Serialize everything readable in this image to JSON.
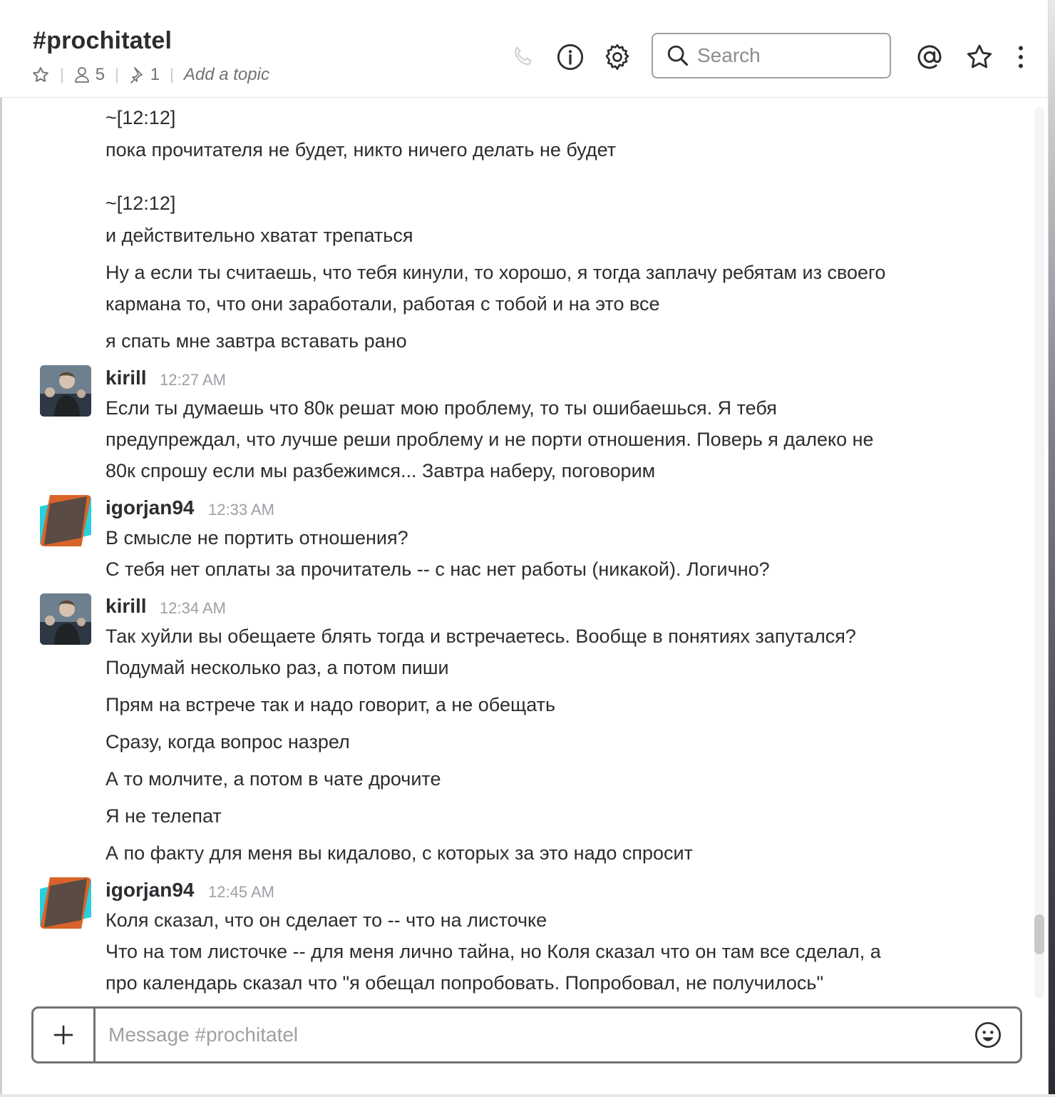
{
  "header": {
    "channel_name": "#prochitatel",
    "member_count": "5",
    "pinned_count": "1",
    "topic_placeholder": "Add a topic",
    "search_placeholder": "Search",
    "icons": [
      "star-outline-icon",
      "person-icon",
      "pin-icon",
      "phone-icon",
      "info-icon",
      "gear-icon",
      "search-icon",
      "at-icon",
      "star-icon",
      "more-vertical-icon"
    ]
  },
  "messages": [
    {
      "text": "~[12:12]"
    },
    {
      "text": "пока прочитателя не будет, никто ничего делать не будет"
    },
    {
      "text": "~[12:12]"
    },
    {
      "text": "и действительно хватат трепаться"
    },
    {
      "text": "Ну а если ты считаешь, что тебя кинули, то хорошо, я тогда заплачу ребятам из своего"
    },
    {
      "text": "кармана то, что они заработали, работая с тобой и на это все"
    },
    {
      "text": "я спать мне завтра вставать рано"
    },
    {
      "user": "kirill",
      "time": "12:27 AM",
      "lines": [
        "Если ты думаешь что 80к решат мою проблему, то ты ошибаешься. Я тебя",
        "предупреждал, что лучше реши проблему и не порти отношения. Поверь я далеко не",
        "80к спрошу если мы разбежимся...  Завтра наберу, поговорим"
      ]
    },
    {
      "user": "igorjan94",
      "time": "12:33 AM",
      "lines": [
        "В смысле не портить отношения?",
        "С тебя нет оплаты за прочитатель -- с нас нет работы (никакой). Логично?"
      ]
    },
    {
      "user": "kirill",
      "time": "12:34 AM",
      "lines": [
        "Так хуйли вы обещаете блять тогда и встречаетесь. Вообще в понятиях запутался?",
        "Подумай несколько раз, а потом пиши",
        "Прям на встрече так и надо говорит, а не обещать",
        "Сразу, когда вопрос назрел",
        "А то молчите, а потом в чате дрочите",
        "Я не телепат",
        "А по факту для меня вы кидалово, с которых за это надо спросит"
      ]
    },
    {
      "user": "igorjan94",
      "time": "12:45 AM",
      "lines": [
        "Коля сказал, что он сделает то -- что на листочке",
        "Что на том листочке -- для меня лично тайна, но Коля сказал что он там все сделал, а",
        "про календарь сказал что \"я обещал попробовать. Попробовал, не получилось\""
      ]
    }
  ],
  "composer": {
    "placeholder": "Message #prochitatel"
  },
  "colors": {
    "text": "#2c2d30",
    "muted": "#717274",
    "timestamp": "#9e9ea6",
    "avatar_cyan": "#29d0dc",
    "avatar_orange": "#d9632a",
    "avatar_dark": "#5a4b44"
  }
}
